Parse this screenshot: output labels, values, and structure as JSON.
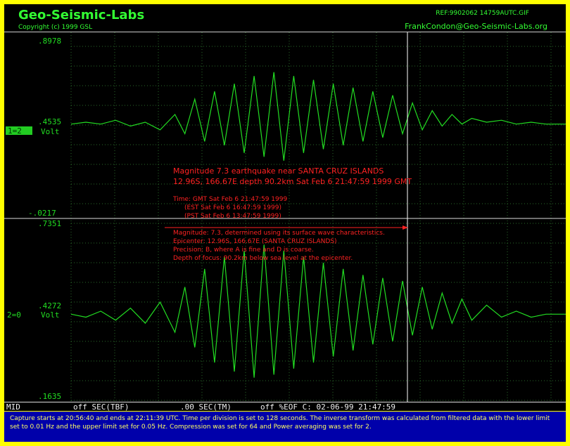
{
  "header": {
    "brand": "Geo-Seismic-Labs",
    "copyright": "Copyright (c) 1999 GSL",
    "ref": "REF:9902062 14759AUTC.GIF",
    "email": "FrankCondon@Geo-Seismic-Labs.org"
  },
  "channels": [
    {
      "top_label": ".8978",
      "mid_label": ".4535",
      "bottom_label": "-.0217",
      "unit": "Volt",
      "tag": "1=2",
      "tag_highlighted": true
    },
    {
      "top_label": ".7351",
      "mid_label": ".4272",
      "bottom_label": ".1635",
      "unit": "Volt",
      "tag": "2=0",
      "tag_highlighted": false
    }
  ],
  "annotation": {
    "headline_1": "Magnitude 7.3 earthquake near SANTA CRUZ ISLANDS",
    "headline_2": "12.96S, 166.67E  depth 90.2km  Sat Feb  6 21:47:59 1999 GMT",
    "time_lines": [
      "Time: GMT Sat Feb  6 21:47:59 1999",
      "(EST Sat Feb  6 16:47:59 1999)",
      "(PST Sat Feb  6 13:47:59 1999)"
    ],
    "detail_lines": [
      "Magnitude: 7.3, determined using its surface wave characteristics.",
      "Epicenter: 12.96S, 166.67E (SANTA CRUZ ISLANDS)",
      "Precision: B, where A is fine and D is coarse.",
      "Depth of focus:  90.2km below sea level at the epicenter."
    ]
  },
  "status_bar": {
    "mode": "MID",
    "tbf": "off SEC(TBF)",
    "tm": ".00 SEC(TM)",
    "eof": "off %EOF C: 02-06-99 21:47:59"
  },
  "footer": {
    "text": "Capture starts at 20:56:40 and ends at 22:11:39 UTC. Time per division is set to 128 seconds. The inverse transform was calculated from filtered data with the lower limit set to 0.01 Hz and the upper limit set for 0.05 Hz. Compression was set for 64 and Power averaging was set for 2."
  },
  "colors": {
    "trace": "#22dd22",
    "grid": "#2a6a2a",
    "annotation": "#ff2222",
    "cursor": "#ffffff",
    "event_marker": "#cc22cc"
  },
  "chart_data": [
    {
      "type": "line",
      "title": "",
      "xlabel": "",
      "ylabel": "Volt",
      "ylim": [
        -0.0217,
        0.8978
      ],
      "baseline": 0.4535,
      "grid": true,
      "x": [
        0.0,
        0.03,
        0.06,
        0.09,
        0.12,
        0.15,
        0.18,
        0.21,
        0.23,
        0.25,
        0.27,
        0.29,
        0.31,
        0.33,
        0.35,
        0.37,
        0.39,
        0.41,
        0.43,
        0.45,
        0.47,
        0.49,
        0.51,
        0.53,
        0.55,
        0.57,
        0.59,
        0.61,
        0.63,
        0.65,
        0.67,
        0.69,
        0.71,
        0.73,
        0.75,
        0.77,
        0.79,
        0.81,
        0.84,
        0.87,
        0.9,
        0.93,
        0.96,
        1.0
      ],
      "series": [
        {
          "values": [
            0.45,
            0.46,
            0.45,
            0.47,
            0.44,
            0.46,
            0.42,
            0.5,
            0.4,
            0.58,
            0.36,
            0.62,
            0.34,
            0.66,
            0.3,
            0.7,
            0.28,
            0.72,
            0.26,
            0.7,
            0.3,
            0.68,
            0.32,
            0.66,
            0.34,
            0.64,
            0.36,
            0.62,
            0.38,
            0.6,
            0.4,
            0.56,
            0.42,
            0.52,
            0.44,
            0.5,
            0.45,
            0.48,
            0.46,
            0.47,
            0.45,
            0.46,
            0.45,
            0.45
          ]
        }
      ]
    },
    {
      "type": "line",
      "title": "",
      "xlabel": "",
      "ylabel": "Volt",
      "ylim": [
        0.1635,
        0.7351
      ],
      "baseline": 0.4272,
      "grid": true,
      "x": [
        0.0,
        0.03,
        0.06,
        0.09,
        0.12,
        0.15,
        0.18,
        0.21,
        0.23,
        0.25,
        0.27,
        0.29,
        0.31,
        0.33,
        0.35,
        0.37,
        0.39,
        0.41,
        0.43,
        0.45,
        0.47,
        0.49,
        0.51,
        0.53,
        0.55,
        0.57,
        0.59,
        0.61,
        0.63,
        0.65,
        0.67,
        0.69,
        0.71,
        0.73,
        0.75,
        0.77,
        0.79,
        0.81,
        0.84,
        0.87,
        0.9,
        0.93,
        0.96,
        1.0
      ],
      "series": [
        {
          "values": [
            0.43,
            0.42,
            0.44,
            0.41,
            0.45,
            0.4,
            0.47,
            0.37,
            0.52,
            0.32,
            0.58,
            0.27,
            0.62,
            0.24,
            0.64,
            0.22,
            0.66,
            0.23,
            0.64,
            0.25,
            0.62,
            0.27,
            0.6,
            0.29,
            0.58,
            0.31,
            0.56,
            0.33,
            0.55,
            0.34,
            0.54,
            0.36,
            0.52,
            0.38,
            0.5,
            0.4,
            0.48,
            0.41,
            0.46,
            0.42,
            0.44,
            0.42,
            0.43,
            0.43
          ]
        }
      ]
    }
  ]
}
